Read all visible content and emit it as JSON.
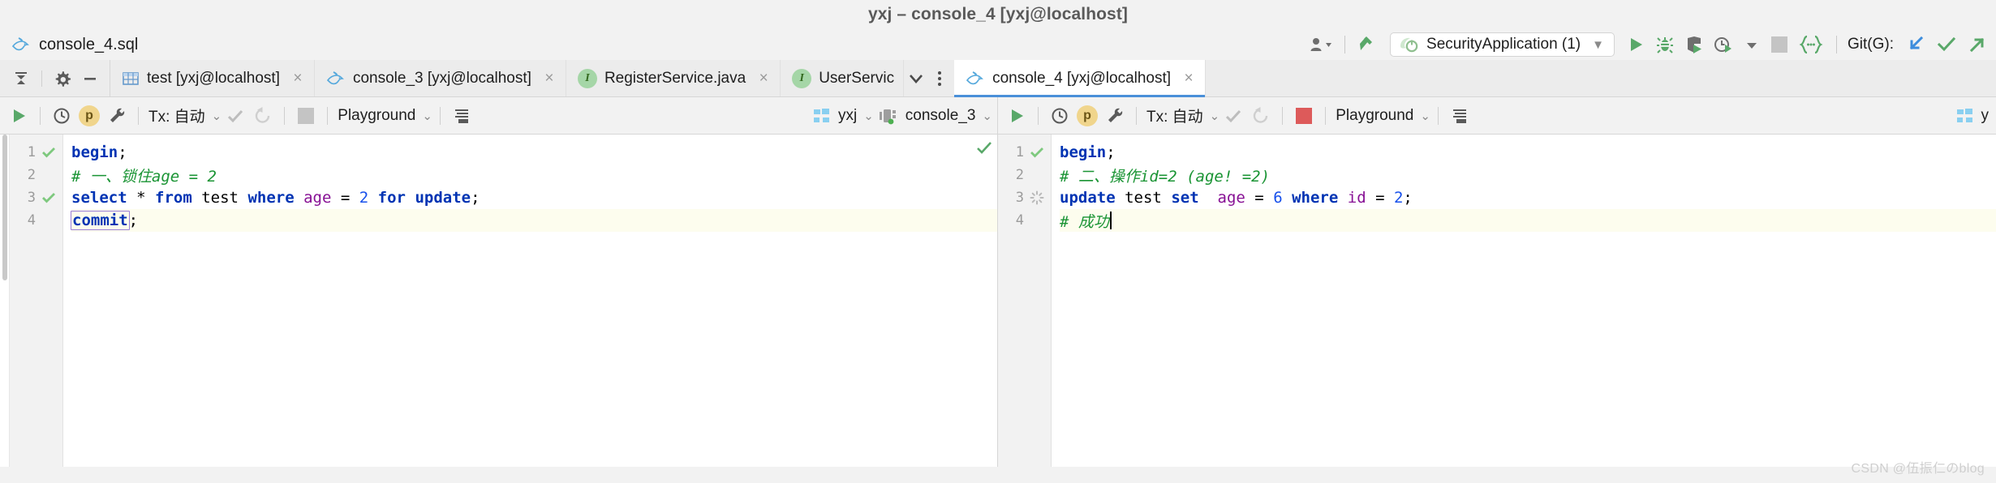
{
  "window": {
    "title": "yxj – console_4 [yxj@localhost]"
  },
  "navbar": {
    "breadcrumb": {
      "icon": "mysql-dolphin-icon",
      "label": "console_4.sql"
    },
    "user_icon": "user-dropdown-icon",
    "build_icon": "build-hammer-icon",
    "run_config": {
      "icon": "spring-boot-icon",
      "label": "SecurityApplication (1)",
      "chevron": "▼"
    },
    "actions": [
      {
        "name": "run-button",
        "icon": "play-icon",
        "color": "#59a869"
      },
      {
        "name": "debug-button",
        "icon": "bug-icon",
        "color": "#59a869"
      },
      {
        "name": "run-with-coverage-button",
        "icon": "coverage-shield-icon",
        "color": "#6e6e6e"
      },
      {
        "name": "profiler-button",
        "icon": "clock-run-icon",
        "color": "#6e6e6e"
      },
      {
        "name": "stop-button",
        "icon": "stop-square-icon",
        "color": "#c4c4c4"
      },
      {
        "name": "code-braces-button",
        "icon": "braces-icon",
        "color": "#59a869"
      }
    ],
    "git": {
      "label": "Git(G):",
      "update_icon": "update-project-icon",
      "commit_icon": "commit-checkmark-icon",
      "push_icon": "push-arrow-icon"
    }
  },
  "tabbar": {
    "tools": [
      {
        "name": "collapse-all-button",
        "icon": "collapse-arrows-icon"
      },
      {
        "name": "settings-button",
        "icon": "gear-icon"
      },
      {
        "name": "hide-button",
        "icon": "minus-icon"
      }
    ],
    "tabs": [
      {
        "name": "tab-test",
        "icon": "table-icon",
        "label": "test [yxj@localhost]",
        "close": "×",
        "active": false
      },
      {
        "name": "tab-console-3",
        "icon": "mysql-dolphin-icon",
        "label": "console_3 [yxj@localhost]",
        "close": "×",
        "active": false
      },
      {
        "name": "tab-register-service",
        "icon": "java-interface-icon",
        "label": "RegisterService.java",
        "close": "×",
        "active": false
      },
      {
        "name": "tab-user-service",
        "icon": "java-interface-icon",
        "label": "UserServic",
        "close": "",
        "active": false
      },
      {
        "name": "tab-console-4",
        "icon": "mysql-dolphin-icon",
        "label": "console_4 [yxj@localhost]",
        "close": "×",
        "active": true
      }
    ],
    "overflow_chevron": "⌄",
    "overflow_menu": "⋮"
  },
  "panes": [
    {
      "id": "left-pane",
      "toolbar": {
        "execute_icon": "play-icon",
        "history_icon": "clock-history-icon",
        "params_icon": "parameters-p-icon",
        "params_label": "p",
        "wrench_icon": "wrench-icon",
        "tx_label": "Tx: 自动",
        "commit_icon": "commit-check-icon",
        "rollback_icon": "rollback-icon",
        "stop_icon": "stop-square-icon",
        "stop_state": "idle",
        "scheme_label": "Playground",
        "grid_icon": "result-grid-icon",
        "db_icon": "schema-icon",
        "db_label": "yxj",
        "session_icon": "session-icon",
        "session_label": "console_3"
      },
      "gutter": [
        {
          "num": "1",
          "mark": "check"
        },
        {
          "num": "2",
          "mark": ""
        },
        {
          "num": "3",
          "mark": "check"
        },
        {
          "num": "4",
          "mark": ""
        }
      ],
      "lines": [
        {
          "n": 1,
          "tokens": [
            {
              "t": "begin",
              "c": "k"
            },
            {
              "t": ";",
              "c": "op"
            }
          ],
          "caret": false
        },
        {
          "n": 2,
          "tokens": [
            {
              "t": "# 一、锁住age = 2",
              "c": "cm"
            }
          ],
          "caret": false
        },
        {
          "n": 3,
          "tokens": [
            {
              "t": "select",
              "c": "k"
            },
            {
              "t": " ",
              "c": "op"
            },
            {
              "t": "*",
              "c": "op"
            },
            {
              "t": " ",
              "c": "op"
            },
            {
              "t": "from",
              "c": "k"
            },
            {
              "t": " ",
              "c": "op"
            },
            {
              "t": "test",
              "c": "id"
            },
            {
              "t": " ",
              "c": "op"
            },
            {
              "t": "where",
              "c": "k"
            },
            {
              "t": " ",
              "c": "op"
            },
            {
              "t": "age",
              "c": "col"
            },
            {
              "t": " = ",
              "c": "op"
            },
            {
              "t": "2",
              "c": "num"
            },
            {
              "t": " ",
              "c": "op"
            },
            {
              "t": "for",
              "c": "k"
            },
            {
              "t": " ",
              "c": "op"
            },
            {
              "t": "update",
              "c": "k"
            },
            {
              "t": ";",
              "c": "op"
            }
          ],
          "caret": false
        },
        {
          "n": 4,
          "tokens": [
            {
              "t": "commit",
              "c": "k boxed"
            },
            {
              "t": ";",
              "c": "op"
            }
          ],
          "caret": false,
          "highlight": true
        }
      ],
      "right_flag": "inspection-ok-check"
    },
    {
      "id": "right-pane",
      "toolbar": {
        "execute_icon": "play-icon",
        "history_icon": "clock-history-icon",
        "params_icon": "parameters-p-icon",
        "params_label": "p",
        "wrench_icon": "wrench-icon",
        "tx_label": "Tx: 自动",
        "commit_icon": "commit-check-icon",
        "rollback_icon": "rollback-icon",
        "stop_icon": "stop-square-icon",
        "stop_state": "active",
        "scheme_label": "Playground",
        "grid_icon": "result-grid-icon",
        "db_icon": "schema-icon",
        "db_label": "y",
        "session_icon": "session-icon",
        "session_label": ""
      },
      "gutter": [
        {
          "num": "1",
          "mark": "check"
        },
        {
          "num": "2",
          "mark": ""
        },
        {
          "num": "3",
          "mark": "spinner"
        },
        {
          "num": "4",
          "mark": ""
        }
      ],
      "lines": [
        {
          "n": 1,
          "tokens": [
            {
              "t": "begin",
              "c": "k"
            },
            {
              "t": ";",
              "c": "op"
            }
          ],
          "caret": false
        },
        {
          "n": 2,
          "tokens": [
            {
              "t": "# 二、操作id=2 (age! =2)",
              "c": "cm"
            }
          ],
          "caret": false
        },
        {
          "n": 3,
          "tokens": [
            {
              "t": "update",
              "c": "k"
            },
            {
              "t": " ",
              "c": "op"
            },
            {
              "t": "test",
              "c": "id"
            },
            {
              "t": " ",
              "c": "op"
            },
            {
              "t": "set",
              "c": "k"
            },
            {
              "t": "  ",
              "c": "op"
            },
            {
              "t": "age",
              "c": "col"
            },
            {
              "t": " = ",
              "c": "op"
            },
            {
              "t": "6",
              "c": "num"
            },
            {
              "t": " ",
              "c": "op"
            },
            {
              "t": "where",
              "c": "k"
            },
            {
              "t": " ",
              "c": "op"
            },
            {
              "t": "id",
              "c": "col"
            },
            {
              "t": " = ",
              "c": "op"
            },
            {
              "t": "2",
              "c": "num"
            },
            {
              "t": ";",
              "c": "op"
            }
          ],
          "caret": false
        },
        {
          "n": 4,
          "tokens": [
            {
              "t": "# 成功",
              "c": "cm"
            }
          ],
          "caret": true,
          "highlight": true
        }
      ],
      "right_flag": ""
    }
  ],
  "watermark": "CSDN @伍振仁のblog",
  "colors": {
    "accent_blue": "#4a90d9",
    "green": "#59a869",
    "red_stop": "#dd5a5a",
    "keyword": "#0033b3",
    "comment": "#1a9434",
    "column": "#871094",
    "number": "#1750eb",
    "caret_line": "#fdfdee"
  }
}
